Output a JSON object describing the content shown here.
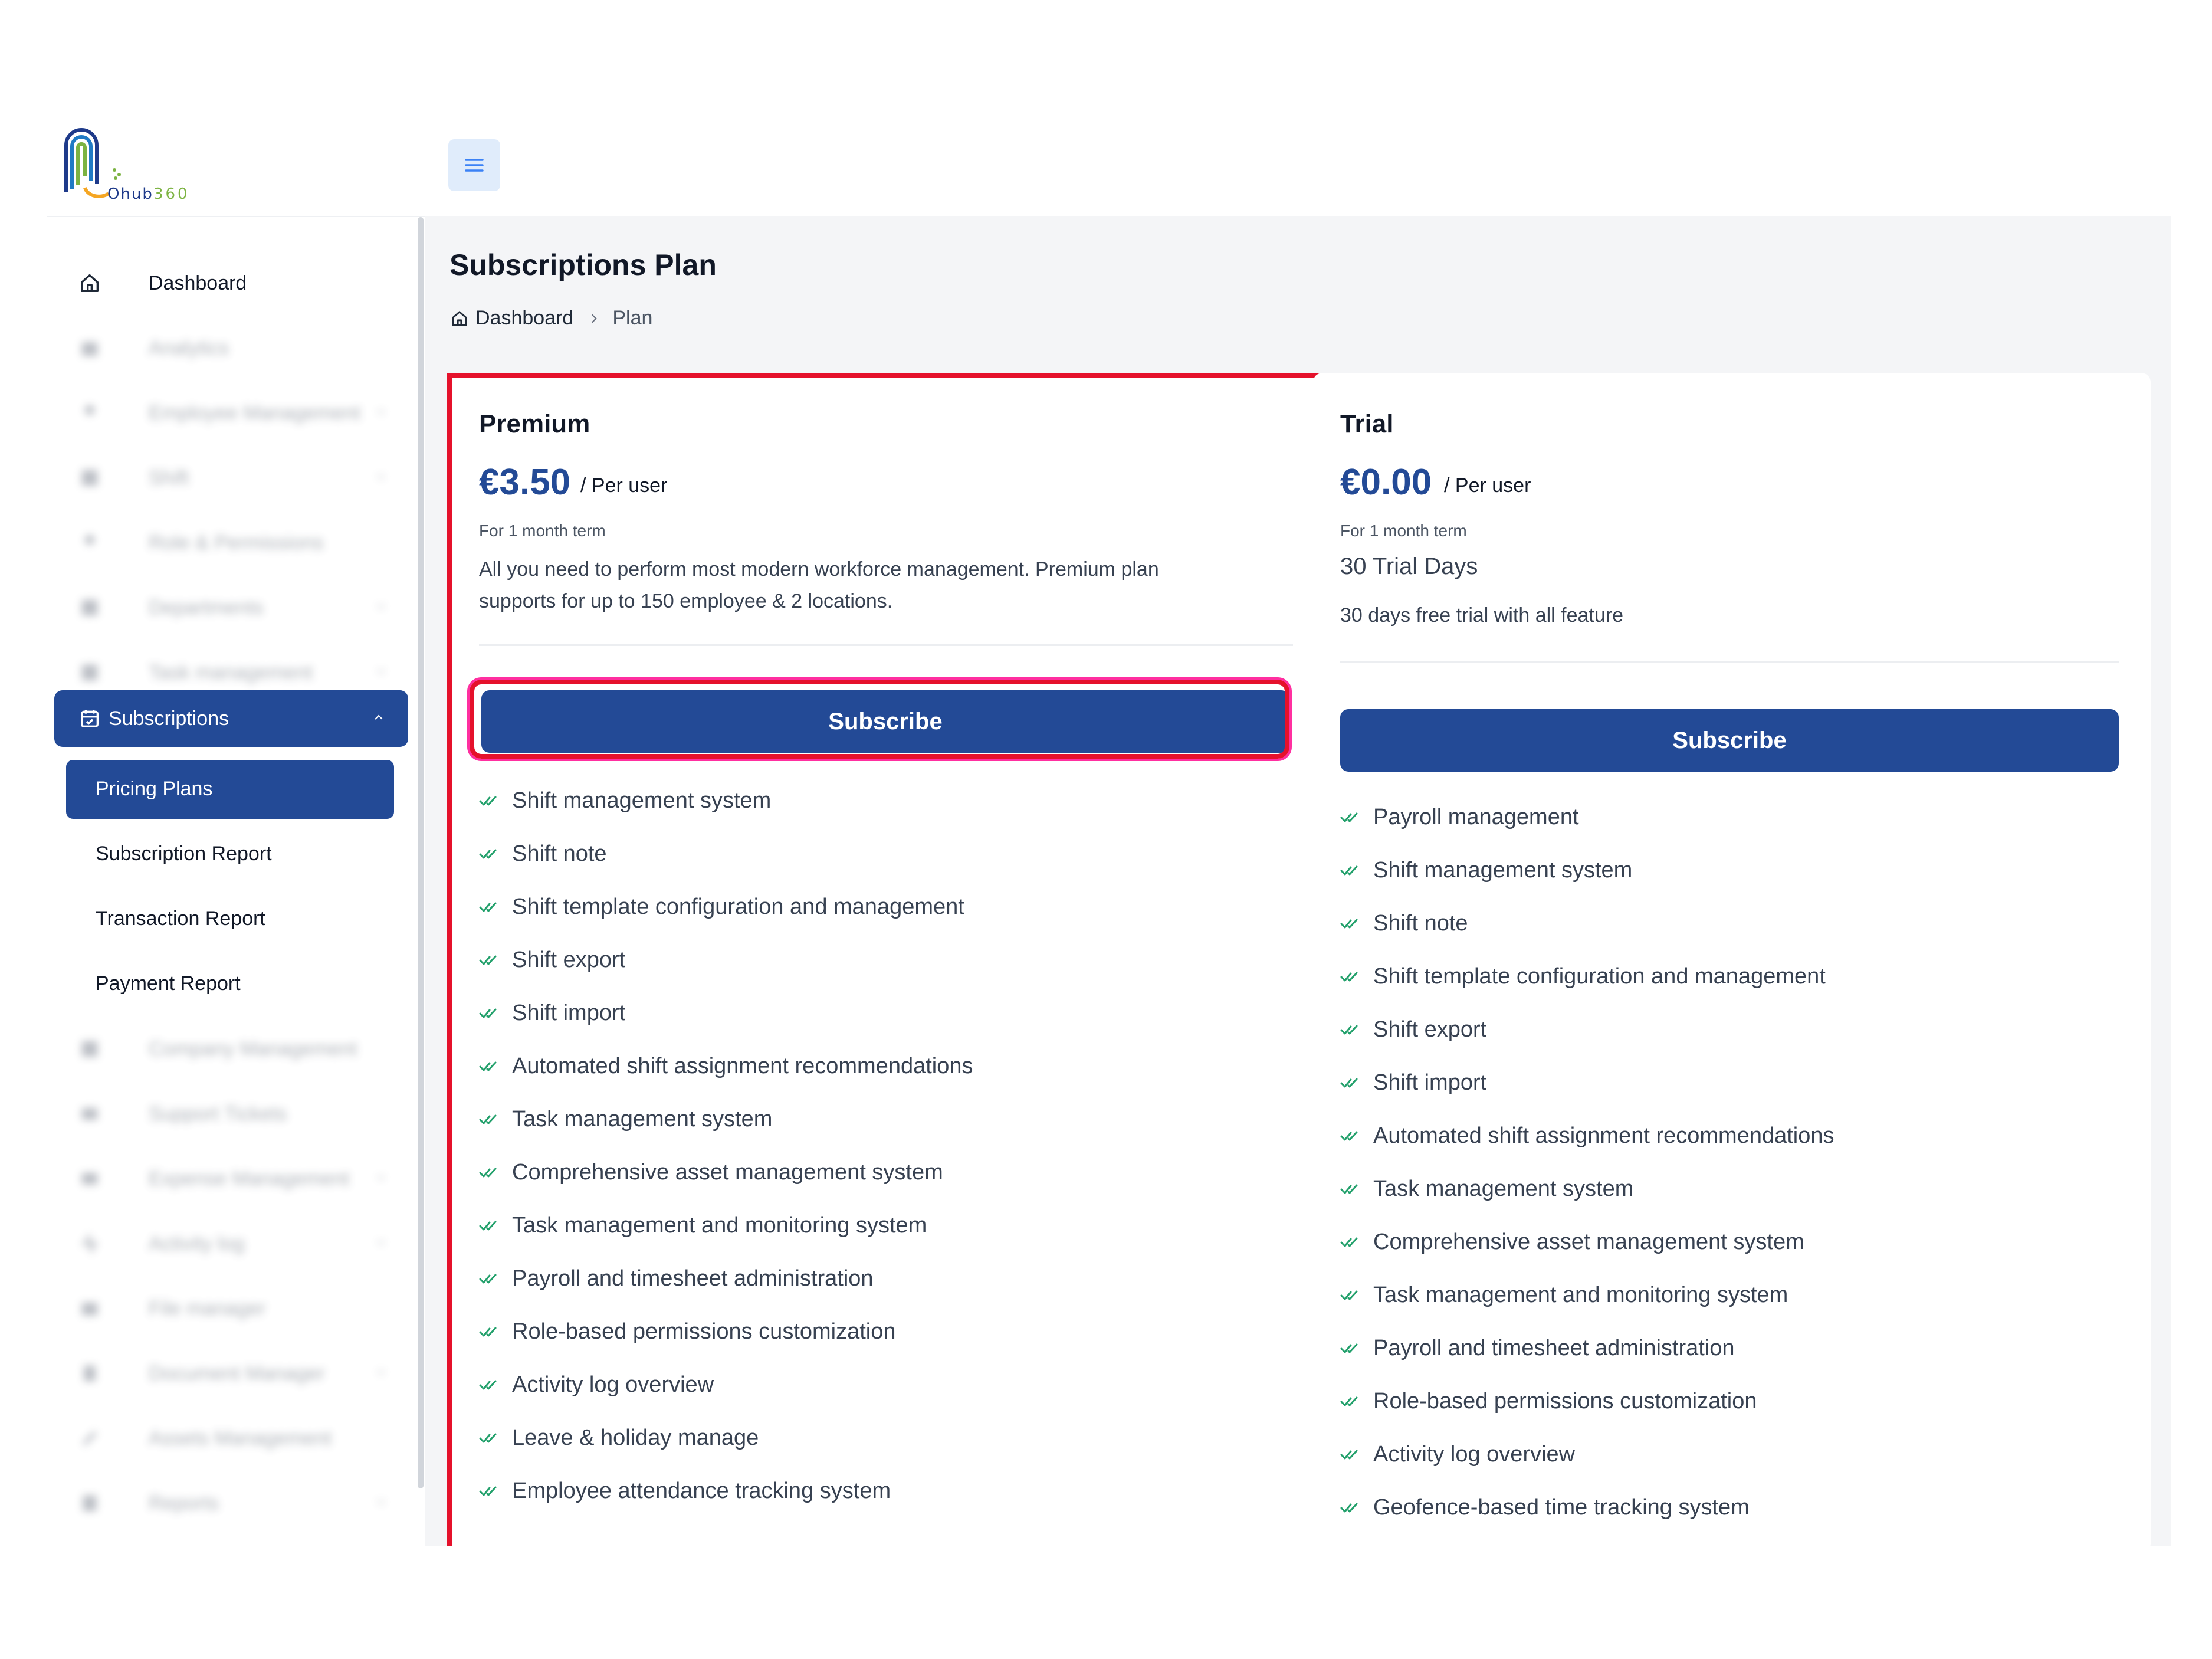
{
  "brand": {
    "logo_text": "Ohub",
    "logo_suffix": "360"
  },
  "sidebar": {
    "dashboard": "Dashboard",
    "blurred_items": [
      "Analytics",
      "Employee Management",
      "Shift",
      "Role & Permissions",
      "Departments",
      "Task management"
    ],
    "subscriptions": "Subscriptions",
    "sub_items": [
      "Pricing Plans",
      "Subscription Report",
      "Transaction Report",
      "Payment Report"
    ],
    "blurred_items_2": [
      "Company Management",
      "Support Tickets",
      "Expense Management",
      "Activity log",
      "File manager",
      "Document Manager",
      "Assets Management",
      "Reports"
    ]
  },
  "page": {
    "title": "Subscriptions Plan",
    "breadcrumb": {
      "home": "Dashboard",
      "separator": ">",
      "current": "Plan"
    }
  },
  "plans": {
    "premium": {
      "name": "Premium",
      "price": "€3.50",
      "per_user": "/ Per user",
      "term": "For 1 month term",
      "description": "All you need to perform most modern workforce management. Premium plan supports for up to 150 employee & 2 locations.",
      "button": "Subscribe",
      "features": [
        "Shift management system",
        "Shift note",
        "Shift template configuration and management",
        "Shift export",
        "Shift import",
        "Automated shift assignment recommendations",
        "Task management system",
        "Comprehensive asset management system",
        "Task management and monitoring system",
        "Payroll and timesheet administration",
        "Role-based permissions customization",
        "Activity log overview",
        "Leave & holiday manage",
        "Employee attendance tracking system"
      ]
    },
    "trial": {
      "name": "Trial",
      "price": "€0.00",
      "per_user": "/ Per user",
      "term": "For 1 month term",
      "days": "30 Trial Days",
      "description": "30 days free trial with all feature",
      "button": "Subscribe",
      "features": [
        "Payroll management",
        "Shift management system",
        "Shift note",
        "Shift template configuration and management",
        "Shift export",
        "Shift import",
        "Automated shift assignment recommendations",
        "Task management system",
        "Comprehensive asset management system",
        "Task management and monitoring system",
        "Payroll and timesheet administration",
        "Role-based permissions customization",
        "Activity log overview",
        "Geofence-based time tracking system"
      ]
    }
  },
  "colors": {
    "primary": "#234a96",
    "highlight_red": "#e5112b",
    "highlight_pink": "#ff2fa0",
    "check_green": "#22a06b"
  }
}
